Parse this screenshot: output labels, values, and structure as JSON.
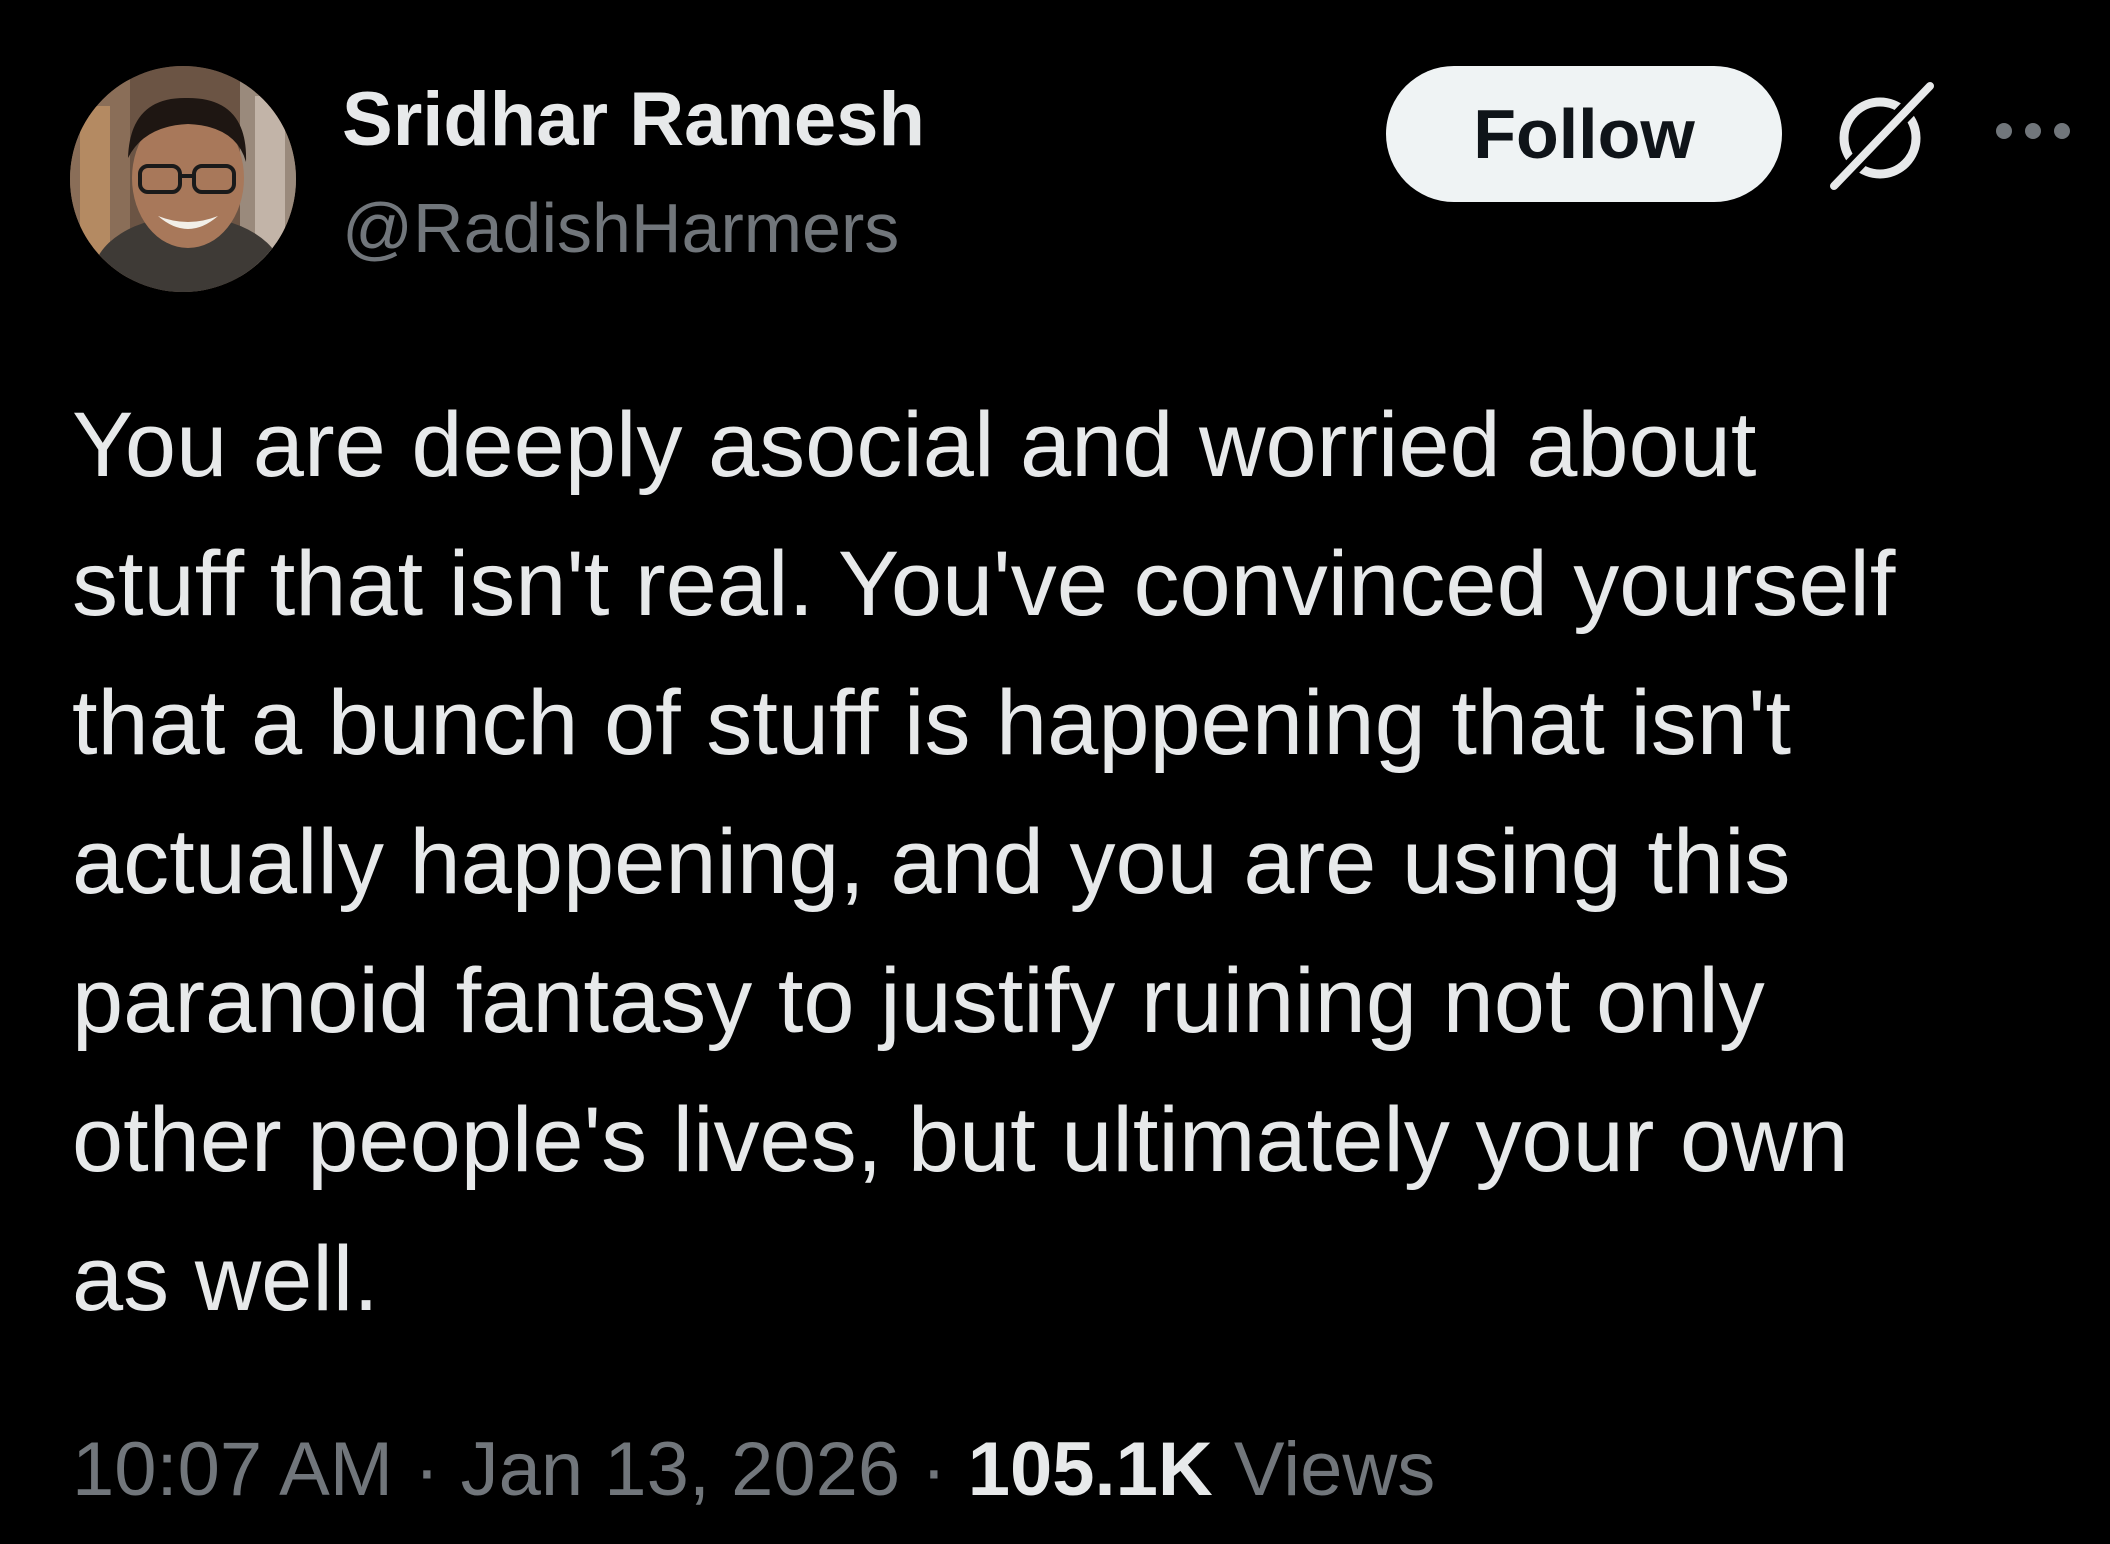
{
  "author": {
    "display_name": "Sridhar Ramesh",
    "handle": "@RadishHarmers"
  },
  "actions": {
    "follow_label": "Follow",
    "grok_icon": "grok-icon",
    "more_icon": "more-icon"
  },
  "post": {
    "lines": [
      "You are deeply asocial and worried about",
      "stuff that isn't real. You've convinced yourself",
      "that a bunch of stuff is happening that isn't",
      "actually happening, and you are using this",
      "paranoid fantasy to justify ruining not only",
      "other people's lives, but ultimately your own",
      "as well."
    ]
  },
  "meta": {
    "time": "10:07 AM",
    "separator1": " · ",
    "date": "Jan 13, 2026",
    "separator2": " · ",
    "views_count": "105.1K",
    "views_label": " Views"
  },
  "colors": {
    "background": "#000000",
    "primary_text": "#e7e9ea",
    "secondary_text": "#71767b",
    "follow_bg": "#eff3f4",
    "follow_text": "#0f1419"
  }
}
